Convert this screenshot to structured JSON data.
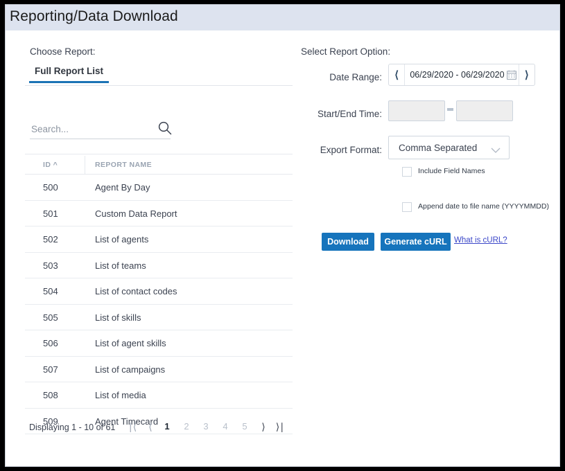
{
  "header": {
    "title": "Reporting/Data Download"
  },
  "left": {
    "choose_report_label": "Choose Report:",
    "tabs": [
      {
        "label": "Full Report List",
        "active": true
      }
    ],
    "search": {
      "placeholder": "Search...",
      "value": "",
      "icon": "search-icon"
    },
    "table": {
      "columns": [
        {
          "key": "id",
          "label": "ID ^",
          "sort": "asc"
        },
        {
          "key": "name",
          "label": "REPORT NAME",
          "sort": "none"
        }
      ],
      "rows": [
        {
          "id": "500",
          "name": "Agent By Day"
        },
        {
          "id": "501",
          "name": "Custom Data Report"
        },
        {
          "id": "502",
          "name": "List of agents"
        },
        {
          "id": "503",
          "name": "List of teams"
        },
        {
          "id": "504",
          "name": "List of contact codes"
        },
        {
          "id": "505",
          "name": "List of skills"
        },
        {
          "id": "506",
          "name": "List of agent skills"
        },
        {
          "id": "507",
          "name": "List of campaigns"
        },
        {
          "id": "508",
          "name": "List of media"
        },
        {
          "id": "509",
          "name": "Agent Timecard"
        }
      ]
    },
    "pagination": {
      "displaying": "Displaying 1 - 10 of 61",
      "first_icon": "chevron-first-icon",
      "prev_icon": "chevron-left-icon",
      "next_icon": "chevron-right-icon",
      "last_icon": "chevron-last-icon",
      "pages": [
        "1",
        "2",
        "3",
        "4",
        "5"
      ],
      "current_page": "1"
    }
  },
  "right": {
    "select_report_option_label": "Select Report Option:",
    "date_range": {
      "label": "Date Range:",
      "value": "06/29/2020 - 06/29/2020",
      "prev_icon": "chevron-left-icon",
      "next_icon": "chevron-right-icon",
      "calendar_icon": "calendar-icon"
    },
    "start_end_time": {
      "label": "Start/End Time:",
      "start_value": "",
      "end_value": "",
      "separator": "-"
    },
    "export_format": {
      "label": "Export Format:",
      "value": "Comma Separated",
      "chevron_icon": "chevron-down-icon",
      "options": [
        "Comma Separated"
      ]
    },
    "checkboxes": [
      {
        "label": "Include Field Names",
        "checked": false
      },
      {
        "label": "Append date to file name (YYYYMMDD)",
        "checked": false
      }
    ],
    "actions": {
      "download_label": "Download",
      "generate_curl_label": "Generate cURL",
      "what_is_curl_label": "What is cURL?"
    }
  },
  "colors": {
    "titlebar_bg": "#dde3ef",
    "accent_blue": "#1b73b5",
    "button_blue": "#1674bc",
    "link_blue": "#3a46c8",
    "text_dark": "#3b4250",
    "muted": "#9aa4b2",
    "border": "#e6e9ee"
  }
}
